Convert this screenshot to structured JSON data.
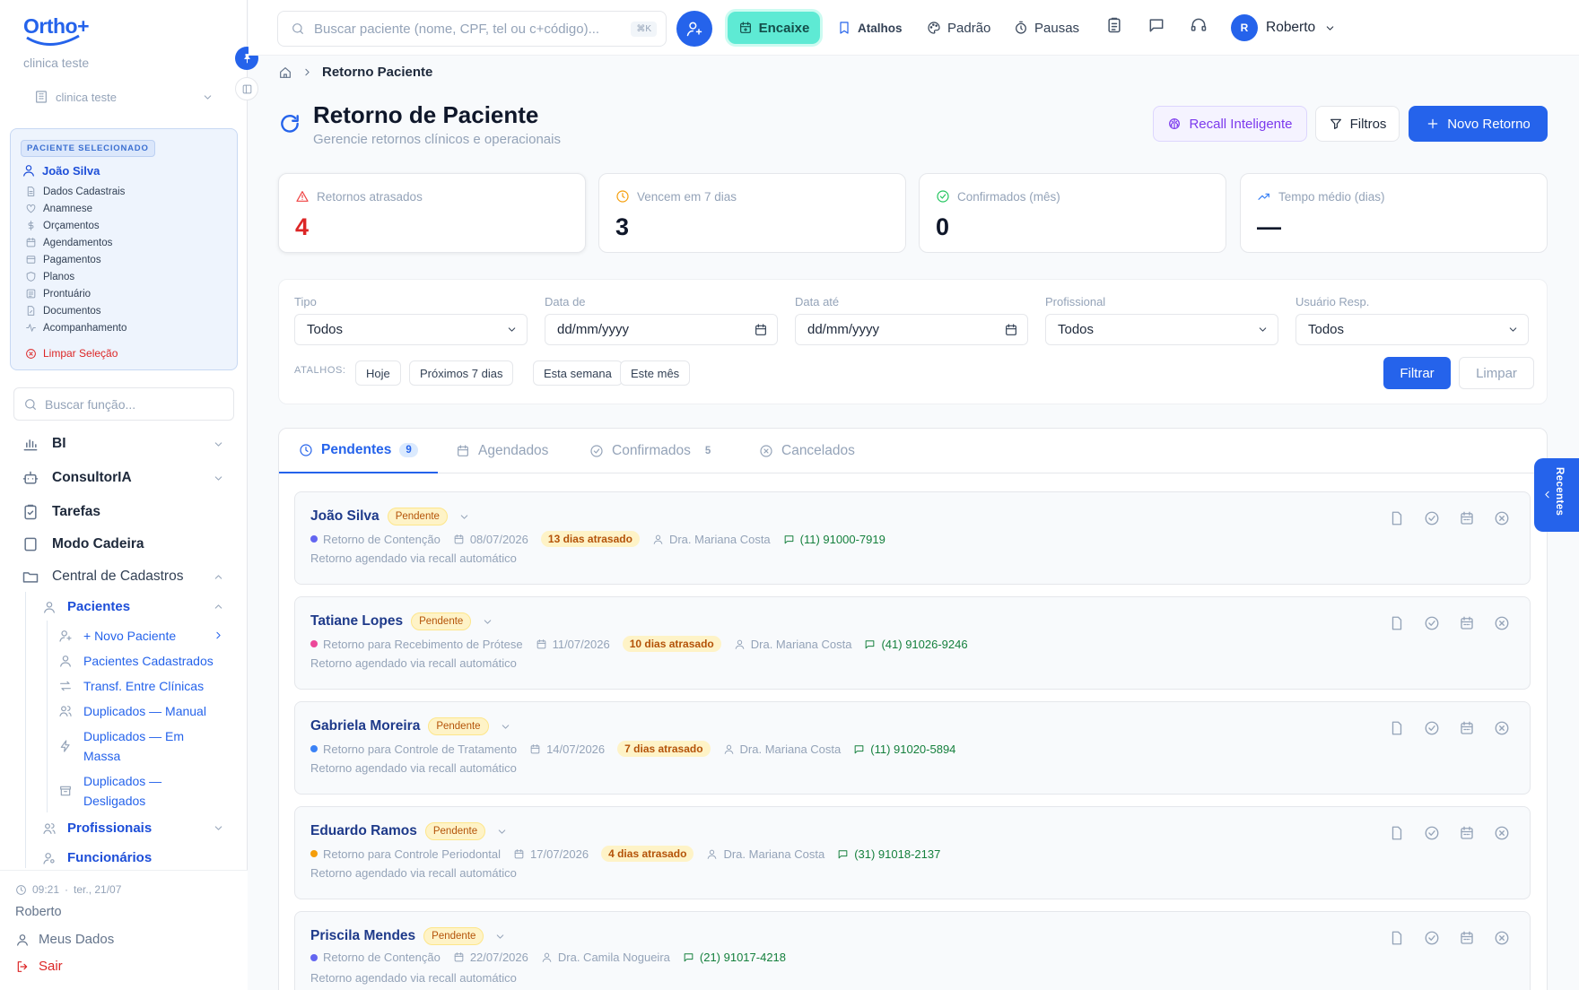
{
  "sidebar": {
    "logo_text": "Ortho+",
    "clinic_name": "clinica teste",
    "clinic_select": "clinica teste",
    "selected_badge": "PACIENTE SELECIONADO",
    "selected_patient": "João Silva",
    "patient_menu": [
      {
        "label": "Dados Cadastrais",
        "icon": "file-icon"
      },
      {
        "label": "Anamnese",
        "icon": "heart-icon"
      },
      {
        "label": "Orçamentos",
        "icon": "dollar-icon"
      },
      {
        "label": "Agendamentos",
        "icon": "calendar-icon"
      },
      {
        "label": "Pagamentos",
        "icon": "receipt-icon"
      },
      {
        "label": "Planos",
        "icon": "shield-icon"
      },
      {
        "label": "Prontuário",
        "icon": "list-icon"
      },
      {
        "label": "Documentos",
        "icon": "doc-edit-icon"
      },
      {
        "label": "Acompanhamento",
        "icon": "pulse-icon"
      }
    ],
    "clear_selection": "Limpar Seleção",
    "function_search_placeholder": "Buscar função...",
    "nav": {
      "bi": "BI",
      "consultoria": "ConsultorIA",
      "tarefas": "Tarefas",
      "modo_cadeira": "Modo Cadeira",
      "central": "Central de Cadastros",
      "pacientes": "Pacientes",
      "novo_paciente": "+ Novo Paciente",
      "pacientes_cadastrados": "Pacientes Cadastrados",
      "transf": "Transf. Entre Clínicas",
      "dup_manual": "Duplicados — Manual",
      "dup_massa_1": "Duplicados — Em",
      "dup_massa_2": "Massa",
      "dup_desl_1": "Duplicados —",
      "dup_desl_2": "Desligados",
      "profissionais": "Profissionais",
      "funcionarios": "Funcionários"
    },
    "footer": {
      "time": "09:21",
      "date": "ter., 21/07",
      "user": "Roberto",
      "my_data": "Meus Dados",
      "logout": "Sair"
    }
  },
  "topbar": {
    "search_placeholder": "Buscar paciente (nome, CPF, tel ou c+código)...",
    "search_kbd": "⌘K",
    "encaixe": "Encaixe",
    "atalhos": "Atalhos",
    "padrao": "Padrão",
    "pausas": "Pausas",
    "avatar_initial": "R",
    "user": "Roberto"
  },
  "breadcrumb": {
    "current": "Retorno Paciente"
  },
  "page": {
    "title": "Retorno de Paciente",
    "subtitle": "Gerencie retornos clínicos e operacionais",
    "recall_button": "Recall Inteligente",
    "filters_button": "Filtros",
    "new_button": "Novo Retorno"
  },
  "stats": [
    {
      "label": "Retornos atrasados",
      "value": "4",
      "color": "#dc2626",
      "icon": "alert-triangle-icon"
    },
    {
      "label": "Vencem em 7 dias",
      "value": "3",
      "color": "#0f172a",
      "icon": "clock-icon"
    },
    {
      "label": "Confirmados (mês)",
      "value": "0",
      "color": "#0f172a",
      "icon": "check-circle-icon"
    },
    {
      "label": "Tempo médio (dias)",
      "value": "—",
      "color": "#0f172a",
      "icon": "trend-icon"
    }
  ],
  "filters": {
    "tipo_label": "Tipo",
    "tipo_value": "Todos",
    "data_de_label": "Data de",
    "data_de_value": "dd/mm/yyyy",
    "data_ate_label": "Data até",
    "data_ate_value": "dd/mm/yyyy",
    "profissional_label": "Profissional",
    "profissional_value": "Todos",
    "usuario_label": "Usuário Resp.",
    "usuario_value": "Todos",
    "shortcuts_label": "ATALHOS:",
    "shortcuts": [
      "Hoje",
      "Próximos 7 dias",
      "Esta semana",
      "Este mês"
    ],
    "filter_button": "Filtrar",
    "clear_button": "Limpar"
  },
  "tabs": [
    {
      "label": "Pendentes",
      "count": "9"
    },
    {
      "label": "Agendados",
      "count": ""
    },
    {
      "label": "Confirmados",
      "count": "5"
    },
    {
      "label": "Cancelados",
      "count": ""
    }
  ],
  "returns": [
    {
      "name": "João Silva",
      "status": "Pendente",
      "type": "Retorno de Contenção",
      "dot": "#6366f1",
      "date": "08/07/2026",
      "late": "13 dias atrasado",
      "professional": "Dra. Mariana Costa",
      "phone": "(11) 91000-7919",
      "note": "Retorno agendado via recall automático"
    },
    {
      "name": "Tatiane Lopes",
      "status": "Pendente",
      "type": "Retorno para Recebimento de Prótese",
      "dot": "#ec4899",
      "date": "11/07/2026",
      "late": "10 dias atrasado",
      "professional": "Dra. Mariana Costa",
      "phone": "(41) 91026-9246",
      "note": "Retorno agendado via recall automático"
    },
    {
      "name": "Gabriela Moreira",
      "status": "Pendente",
      "type": "Retorno para Controle de Tratamento",
      "dot": "#3b82f6",
      "date": "14/07/2026",
      "late": "7 dias atrasado",
      "professional": "Dra. Mariana Costa",
      "phone": "(11) 91020-5894",
      "note": "Retorno agendado via recall automático"
    },
    {
      "name": "Eduardo Ramos",
      "status": "Pendente",
      "type": "Retorno para Controle Periodontal",
      "dot": "#f59e0b",
      "date": "17/07/2026",
      "late": "4 dias atrasado",
      "professional": "Dra. Mariana Costa",
      "phone": "(31) 91018-2137",
      "note": "Retorno agendado via recall automático"
    },
    {
      "name": "Priscila Mendes",
      "status": "Pendente",
      "type": "Retorno de Contenção",
      "dot": "#6366f1",
      "date": "22/07/2026",
      "late": "",
      "professional": "Dra. Camila Nogueira",
      "phone": "(21) 91017-4218",
      "note": "Retorno agendado via recall automático"
    }
  ],
  "recentes_label": "Recentes"
}
